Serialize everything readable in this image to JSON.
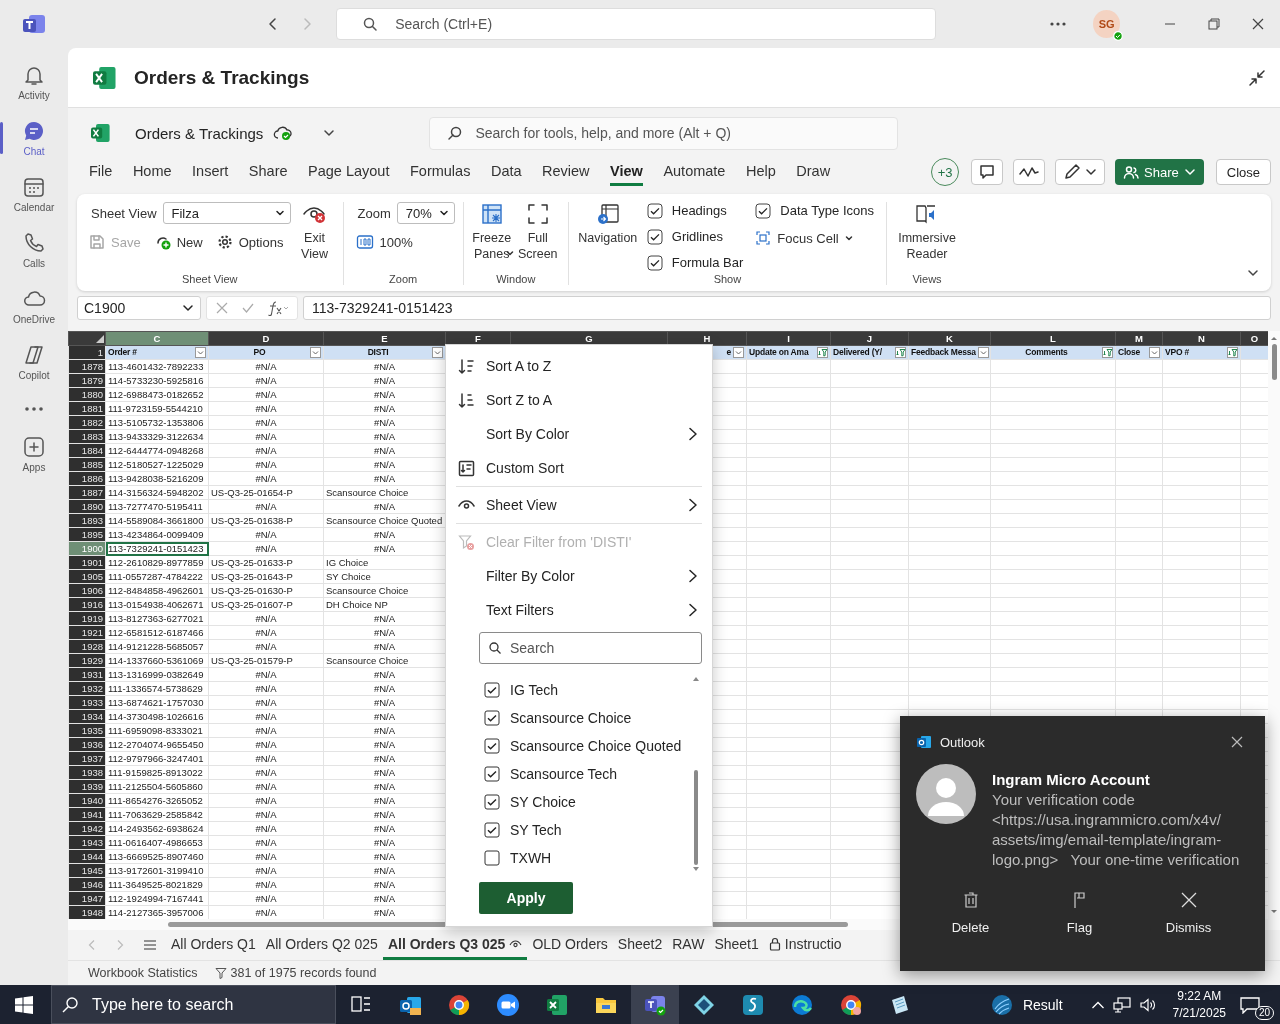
{
  "titlebar": {
    "search": {
      "placeholder": "Search (Ctrl+E)"
    },
    "avatar": "SG"
  },
  "rail": [
    {
      "label": "Activity",
      "selected": false
    },
    {
      "label": "Chat",
      "selected": true
    },
    {
      "label": "Calendar",
      "selected": false
    },
    {
      "label": "Calls",
      "selected": false
    },
    {
      "label": "OneDrive",
      "selected": false
    },
    {
      "label": "Copilot",
      "selected": false
    }
  ],
  "rail_apps": {
    "label": "Apps"
  },
  "app_header": {
    "title": "Orders & Trackings"
  },
  "workbook": {
    "title": "Orders & Trackings",
    "search": {
      "placeholder": "Search for tools, help, and more (Alt + Q)"
    }
  },
  "menu_tabs": [
    {
      "label": "File",
      "selected": false
    },
    {
      "label": "Home",
      "selected": false
    },
    {
      "label": "Insert",
      "selected": false
    },
    {
      "label": "Share",
      "selected": false
    },
    {
      "label": "Page Layout",
      "selected": false
    },
    {
      "label": "Formulas",
      "selected": false
    },
    {
      "label": "Data",
      "selected": false
    },
    {
      "label": "Review",
      "selected": false
    },
    {
      "label": "View",
      "selected": true
    },
    {
      "label": "Automate",
      "selected": false
    },
    {
      "label": "Help",
      "selected": false
    },
    {
      "label": "Draw",
      "selected": false
    }
  ],
  "actions": {
    "collaborators": "+3",
    "share": "Share",
    "close": "Close"
  },
  "ribbon": {
    "sheet_view": {
      "label": "Sheet View",
      "value": "Filza",
      "save": {
        "label": "Save",
        "disabled": true
      },
      "new": "New",
      "options": "Options",
      "exit": "Exit View",
      "caption": "Sheet View"
    },
    "zoom": {
      "label": "Zoom",
      "value": "70%",
      "hundred": "100%",
      "caption": "Zoom"
    },
    "window": {
      "freeze": "Freeze Panes",
      "full": "Full Screen",
      "caption": "Window"
    },
    "show": {
      "navigation": "Navigation",
      "checks": [
        {
          "label": "Headings",
          "checked": true
        },
        {
          "label": "Gridlines",
          "checked": true
        },
        {
          "label": "Formula Bar",
          "checked": true
        },
        {
          "label": "Data Type Icons",
          "checked": true
        }
      ],
      "focus": "Focus Cell",
      "caption": "Show"
    },
    "views": {
      "reader": "Immersive Reader",
      "caption": "Views"
    }
  },
  "formula_bar": {
    "name_box": "C1900",
    "formula": "113-7329241-0151423"
  },
  "grid": {
    "header_row": "1",
    "columns": [
      {
        "letter": "C",
        "heading": "Order #",
        "selected": true,
        "filtered": false
      },
      {
        "letter": "D",
        "heading": "PO",
        "selected": false,
        "filtered": false
      },
      {
        "letter": "E",
        "heading": "DISTI",
        "selected": false,
        "filtered": false
      },
      {
        "letter": "F",
        "selected": false
      },
      {
        "letter": "G",
        "selected": false
      },
      {
        "letter": "H",
        "heading": "e",
        "selected": false,
        "filtered": false
      },
      {
        "letter": "I",
        "heading": "Update on Ama",
        "selected": false,
        "filtered": true
      },
      {
        "letter": "J",
        "heading": "Delivered (Y/",
        "selected": false,
        "filtered": true
      },
      {
        "letter": "K",
        "heading": "Feedback Messa",
        "selected": false,
        "filtered": false
      },
      {
        "letter": "L",
        "heading": "Comments",
        "selected": false,
        "filtered": true
      },
      {
        "letter": "M",
        "heading": "Close",
        "selected": false,
        "filtered": false
      },
      {
        "letter": "N",
        "heading": "VPO #",
        "selected": false,
        "filtered": true
      },
      {
        "letter": "O",
        "selected": false
      }
    ],
    "rows": [
      {
        "number": "1878",
        "selected": false,
        "matched": false,
        "cells": [
          "113-4601432-7892233",
          "#N/A",
          "#N/A"
        ]
      },
      {
        "number": "1879",
        "selected": false,
        "matched": false,
        "cells": [
          "114-5733230-5925816",
          "#N/A",
          "#N/A"
        ]
      },
      {
        "number": "1880",
        "selected": false,
        "matched": false,
        "cells": [
          "112-6988473-0182652",
          "#N/A",
          "#N/A"
        ]
      },
      {
        "number": "1881",
        "selected": false,
        "matched": false,
        "cells": [
          "111-9723159-5544210",
          "#N/A",
          "#N/A"
        ]
      },
      {
        "number": "1882",
        "selected": false,
        "matched": false,
        "cells": [
          "113-5105732-1353806",
          "#N/A",
          "#N/A"
        ]
      },
      {
        "number": "1883",
        "selected": false,
        "matched": false,
        "cells": [
          "113-9433329-3122634",
          "#N/A",
          "#N/A"
        ]
      },
      {
        "number": "1884",
        "selected": false,
        "matched": false,
        "cells": [
          "112-6444774-0948268",
          "#N/A",
          "#N/A"
        ]
      },
      {
        "number": "1885",
        "selected": false,
        "matched": false,
        "cells": [
          "112-5180527-1225029",
          "#N/A",
          "#N/A"
        ]
      },
      {
        "number": "1886",
        "selected": false,
        "matched": false,
        "cells": [
          "113-9428038-5216209",
          "#N/A",
          "#N/A"
        ]
      },
      {
        "number": "1887",
        "selected": false,
        "matched": true,
        "cells": [
          "114-3156324-5948202",
          "US-Q3-25-01654-P",
          "Scansource Choice"
        ]
      },
      {
        "number": "1890",
        "selected": false,
        "matched": false,
        "cells": [
          "113-7277470-5195411",
          "#N/A",
          "#N/A"
        ]
      },
      {
        "number": "1893",
        "selected": false,
        "matched": true,
        "cells": [
          "114-5589084-3661800",
          "US-Q3-25-01638-P",
          "Scansource Choice Quoted"
        ]
      },
      {
        "number": "1895",
        "selected": false,
        "matched": false,
        "cells": [
          "113-4234864-0099409",
          "#N/A",
          "#N/A"
        ]
      },
      {
        "number": "1900",
        "selected": true,
        "matched": false,
        "cells": [
          "113-7329241-0151423",
          "#N/A",
          "#N/A"
        ]
      },
      {
        "number": "1901",
        "selected": false,
        "matched": true,
        "cells": [
          "112-2610829-8977859",
          "US-Q3-25-01633-P",
          "IG Choice"
        ]
      },
      {
        "number": "1905",
        "selected": false,
        "matched": true,
        "cells": [
          "111-0557287-4784222",
          "US-Q3-25-01643-P",
          "SY Choice"
        ]
      },
      {
        "number": "1906",
        "selected": false,
        "matched": true,
        "cells": [
          "112-8484858-4962601",
          "US-Q3-25-01630-P",
          "Scansource Choice"
        ]
      },
      {
        "number": "1916",
        "selected": false,
        "matched": true,
        "cells": [
          "113-0154938-4062671",
          "US-Q3-25-01607-P",
          "DH Choice NP"
        ]
      },
      {
        "number": "1919",
        "selected": false,
        "matched": false,
        "cells": [
          "113-8127363-6277021",
          "#N/A",
          "#N/A"
        ]
      },
      {
        "number": "1921",
        "selected": false,
        "matched": false,
        "cells": [
          "112-6581512-6187466",
          "#N/A",
          "#N/A"
        ]
      },
      {
        "number": "1928",
        "selected": false,
        "matched": false,
        "cells": [
          "114-9121228-5685057",
          "#N/A",
          "#N/A"
        ]
      },
      {
        "number": "1929",
        "selected": false,
        "matched": true,
        "cells": [
          "114-1337660-5361069",
          "US-Q3-25-01579-P",
          "Scansource Choice"
        ]
      },
      {
        "number": "1931",
        "selected": false,
        "matched": false,
        "cells": [
          "113-1316999-0382649",
          "#N/A",
          "#N/A"
        ]
      },
      {
        "number": "1932",
        "selected": false,
        "matched": false,
        "cells": [
          "111-1336574-5738629",
          "#N/A",
          "#N/A"
        ]
      },
      {
        "number": "1933",
        "selected": false,
        "matched": false,
        "cells": [
          "113-6874621-1757030",
          "#N/A",
          "#N/A"
        ]
      },
      {
        "number": "1934",
        "selected": false,
        "matched": false,
        "cells": [
          "114-3730498-1026616",
          "#N/A",
          "#N/A"
        ]
      },
      {
        "number": "1935",
        "selected": false,
        "matched": false,
        "cells": [
          "111-6959098-8333021",
          "#N/A",
          "#N/A"
        ]
      },
      {
        "number": "1936",
        "selected": false,
        "matched": false,
        "cells": [
          "112-2704074-9655450",
          "#N/A",
          "#N/A"
        ]
      },
      {
        "number": "1937",
        "selected": false,
        "matched": false,
        "cells": [
          "112-9797966-3247401",
          "#N/A",
          "#N/A"
        ]
      },
      {
        "number": "1938",
        "selected": false,
        "matched": false,
        "cells": [
          "111-9159825-8913022",
          "#N/A",
          "#N/A"
        ]
      },
      {
        "number": "1939",
        "selected": false,
        "matched": false,
        "cells": [
          "111-2125504-5605860",
          "#N/A",
          "#N/A"
        ]
      },
      {
        "number": "1940",
        "selected": false,
        "matched": false,
        "cells": [
          "111-8654276-3265052",
          "#N/A",
          "#N/A"
        ]
      },
      {
        "number": "1941",
        "selected": false,
        "matched": false,
        "cells": [
          "111-7063629-2585842",
          "#N/A",
          "#N/A"
        ]
      },
      {
        "number": "1942",
        "selected": false,
        "matched": false,
        "cells": [
          "114-2493562-6938624",
          "#N/A",
          "#N/A"
        ]
      },
      {
        "number": "1943",
        "selected": false,
        "matched": false,
        "cells": [
          "111-0616407-4986653",
          "#N/A",
          "#N/A"
        ]
      },
      {
        "number": "1944",
        "selected": false,
        "matched": false,
        "cells": [
          "113-6669525-8907460",
          "#N/A",
          "#N/A"
        ]
      },
      {
        "number": "1945",
        "selected": false,
        "matched": false,
        "cells": [
          "113-9172601-3199410",
          "#N/A",
          "#N/A"
        ]
      },
      {
        "number": "1946",
        "selected": false,
        "matched": false,
        "cells": [
          "111-3649525-8021829",
          "#N/A",
          "#N/A"
        ]
      },
      {
        "number": "1947",
        "selected": false,
        "matched": false,
        "cells": [
          "112-1924994-7167441",
          "#N/A",
          "#N/A"
        ]
      },
      {
        "number": "1948",
        "selected": false,
        "matched": false,
        "cells": [
          "114-2127365-3957006",
          "#N/A",
          "#N/A"
        ]
      }
    ]
  },
  "filter_menu": {
    "items": [
      {
        "kind": "item",
        "label": "Sort A to Z",
        "submenu": false,
        "disabled": false
      },
      {
        "kind": "item",
        "label": "Sort Z to A",
        "submenu": false,
        "disabled": false
      },
      {
        "kind": "item",
        "label": "Sort By Color",
        "submenu": true,
        "disabled": false
      },
      {
        "kind": "item",
        "label": "Custom Sort",
        "submenu": false,
        "disabled": false
      },
      {
        "kind": "divider"
      },
      {
        "kind": "item",
        "label": "Sheet View",
        "submenu": true,
        "disabled": false
      },
      {
        "kind": "divider"
      },
      {
        "kind": "item",
        "label": "Clear Filter from 'DISTI'",
        "submenu": false,
        "disabled": true
      },
      {
        "kind": "item",
        "label": "Filter By Color",
        "submenu": true,
        "disabled": false
      },
      {
        "kind": "item",
        "label": "Text Filters",
        "submenu": true,
        "disabled": false
      }
    ],
    "search": {
      "placeholder": "Search"
    },
    "options": [
      {
        "label": "IG Tech",
        "checked": true
      },
      {
        "label": "Scansource Choice",
        "checked": true
      },
      {
        "label": "Scansource Choice Quoted",
        "checked": true
      },
      {
        "label": "Scansource Tech",
        "checked": true
      },
      {
        "label": "SY Choice",
        "checked": true
      },
      {
        "label": "SY Tech",
        "checked": true
      },
      {
        "label": "TXWH",
        "checked": false
      }
    ],
    "apply": "Apply"
  },
  "sheet_tabs": [
    {
      "label": "All Orders Q1",
      "selected": false,
      "kind": "plain"
    },
    {
      "label": "All Orders Q2 025",
      "selected": false,
      "kind": "plain"
    },
    {
      "label": "All Orders Q3 025",
      "selected": true,
      "kind": "view"
    },
    {
      "label": "OLD Orders",
      "selected": false,
      "kind": "plain"
    },
    {
      "label": "Sheet2",
      "selected": false,
      "kind": "plain"
    },
    {
      "label": "RAW",
      "selected": false,
      "kind": "plain"
    },
    {
      "label": "Sheet1",
      "selected": false,
      "kind": "plain"
    },
    {
      "label": "Instructio",
      "selected": false,
      "kind": "locked"
    }
  ],
  "status_bar": {
    "stats": "Workbook Statistics",
    "records": "381 of 1975 records found"
  },
  "notification": {
    "app": "Outlook",
    "sender": "Ingram Micro Account",
    "body": "Your verification code\n<https://usa.ingrammicro.com/x4v/\nassets/img/email-template/ingram-\nlogo.png>   Your one-time verification",
    "actions": [
      "Delete",
      "Flag",
      "Dismiss"
    ]
  },
  "taskbar": {
    "search": {
      "placeholder": "Type here to search"
    },
    "weather": "Result",
    "time": "9:22 AM",
    "date": "7/21/2025",
    "notifications": "20"
  }
}
